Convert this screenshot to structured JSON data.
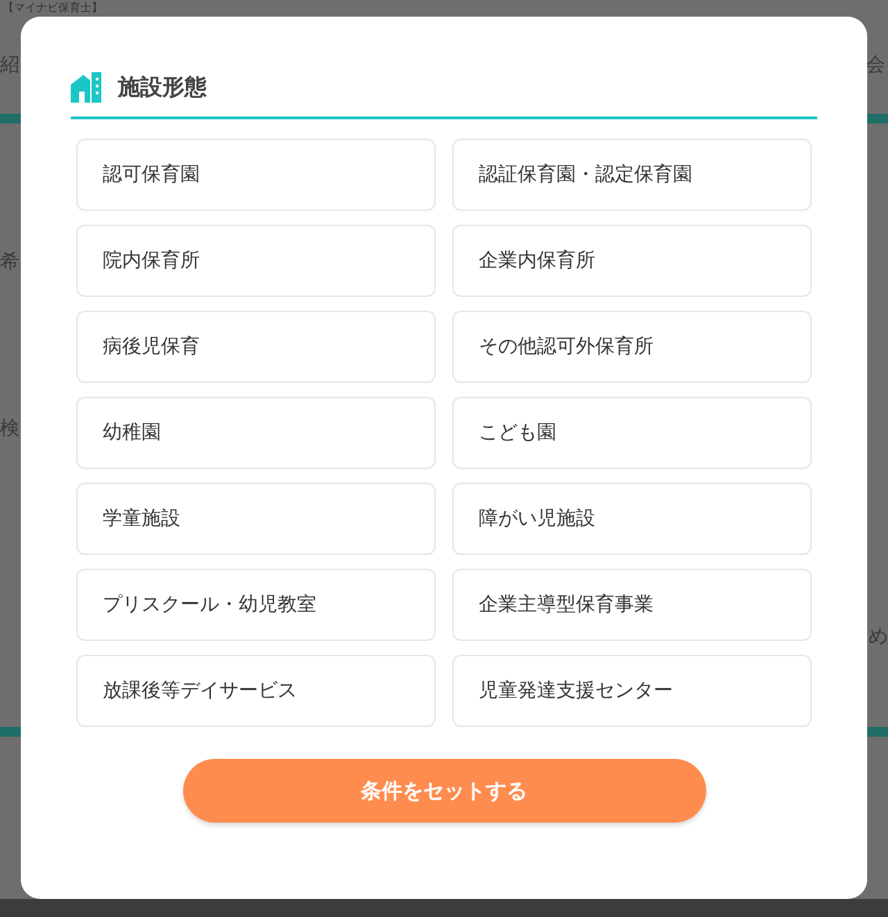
{
  "background_page": {
    "header": "【マイナビ保育士】",
    "left_fragments": [
      "紹",
      "希",
      "検"
    ],
    "right_fragments": [
      "会",
      "め"
    ]
  },
  "modal": {
    "title": "施設形態",
    "options": [
      {
        "label": "認可保育園"
      },
      {
        "label": "認証保育園・認定保育園"
      },
      {
        "label": "院内保育所"
      },
      {
        "label": "企業内保育所"
      },
      {
        "label": "病後児保育"
      },
      {
        "label": "その他認可外保育所"
      },
      {
        "label": "幼稚園"
      },
      {
        "label": "こども園"
      },
      {
        "label": "学童施設"
      },
      {
        "label": "障がい児施設"
      },
      {
        "label": "プリスクール・幼児教室"
      },
      {
        "label": "企業主導型保育事業"
      },
      {
        "label": "放課後等デイサービス"
      },
      {
        "label": "児童発達支援センター"
      }
    ],
    "submit": "条件をセットする"
  }
}
